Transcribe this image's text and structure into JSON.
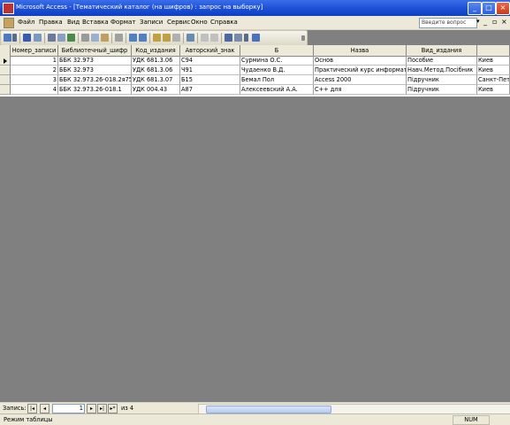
{
  "window": {
    "title": "Microsoft Access - [Тематический каталог (на шифров) : запрос на выборку]"
  },
  "menu": {
    "items": [
      "Файл",
      "Правка",
      "Вид",
      "Вставка",
      "Формат",
      "Записи",
      "Сервис",
      "Окно",
      "Справка"
    ],
    "help_placeholder": "Введите вопрос"
  },
  "grid": {
    "columns": [
      "Номер_записи",
      "Библиотечный_шифр",
      "Код_издания",
      "Авторский_знак",
      "Б",
      "Назва",
      "Вид_издания",
      ""
    ],
    "rows": [
      [
        "1",
        "ББК 32.973",
        "УДК 681.3.06",
        "С94",
        "Сурмина О.С.",
        "Основ",
        "Пособие",
        "Киев"
      ],
      [
        "2",
        "ББК 32.973",
        "УДК 681.3.06",
        "Ч91",
        "Чудаенко В.Д.",
        "Практический курс информатики",
        "Навч.Метод.Посібник",
        "Киев"
      ],
      [
        "3",
        "ББК 32.973.26-018.2я75",
        "УДК 681.3.07",
        "Б15",
        "Бемал Пол",
        "Access 2000",
        "Підручник",
        "Санкт-Пет"
      ],
      [
        "4",
        "ББК 32.973.26-018.1",
        "УДК 004.43",
        "А87",
        "Алексеевский А.А.",
        "C++ для",
        "Підручник",
        "Киев"
      ]
    ]
  },
  "navigator": {
    "label": "Запись:",
    "current": "1",
    "total": "из 4"
  },
  "status": {
    "text": "Режим таблицы",
    "indicator": "NUM"
  }
}
